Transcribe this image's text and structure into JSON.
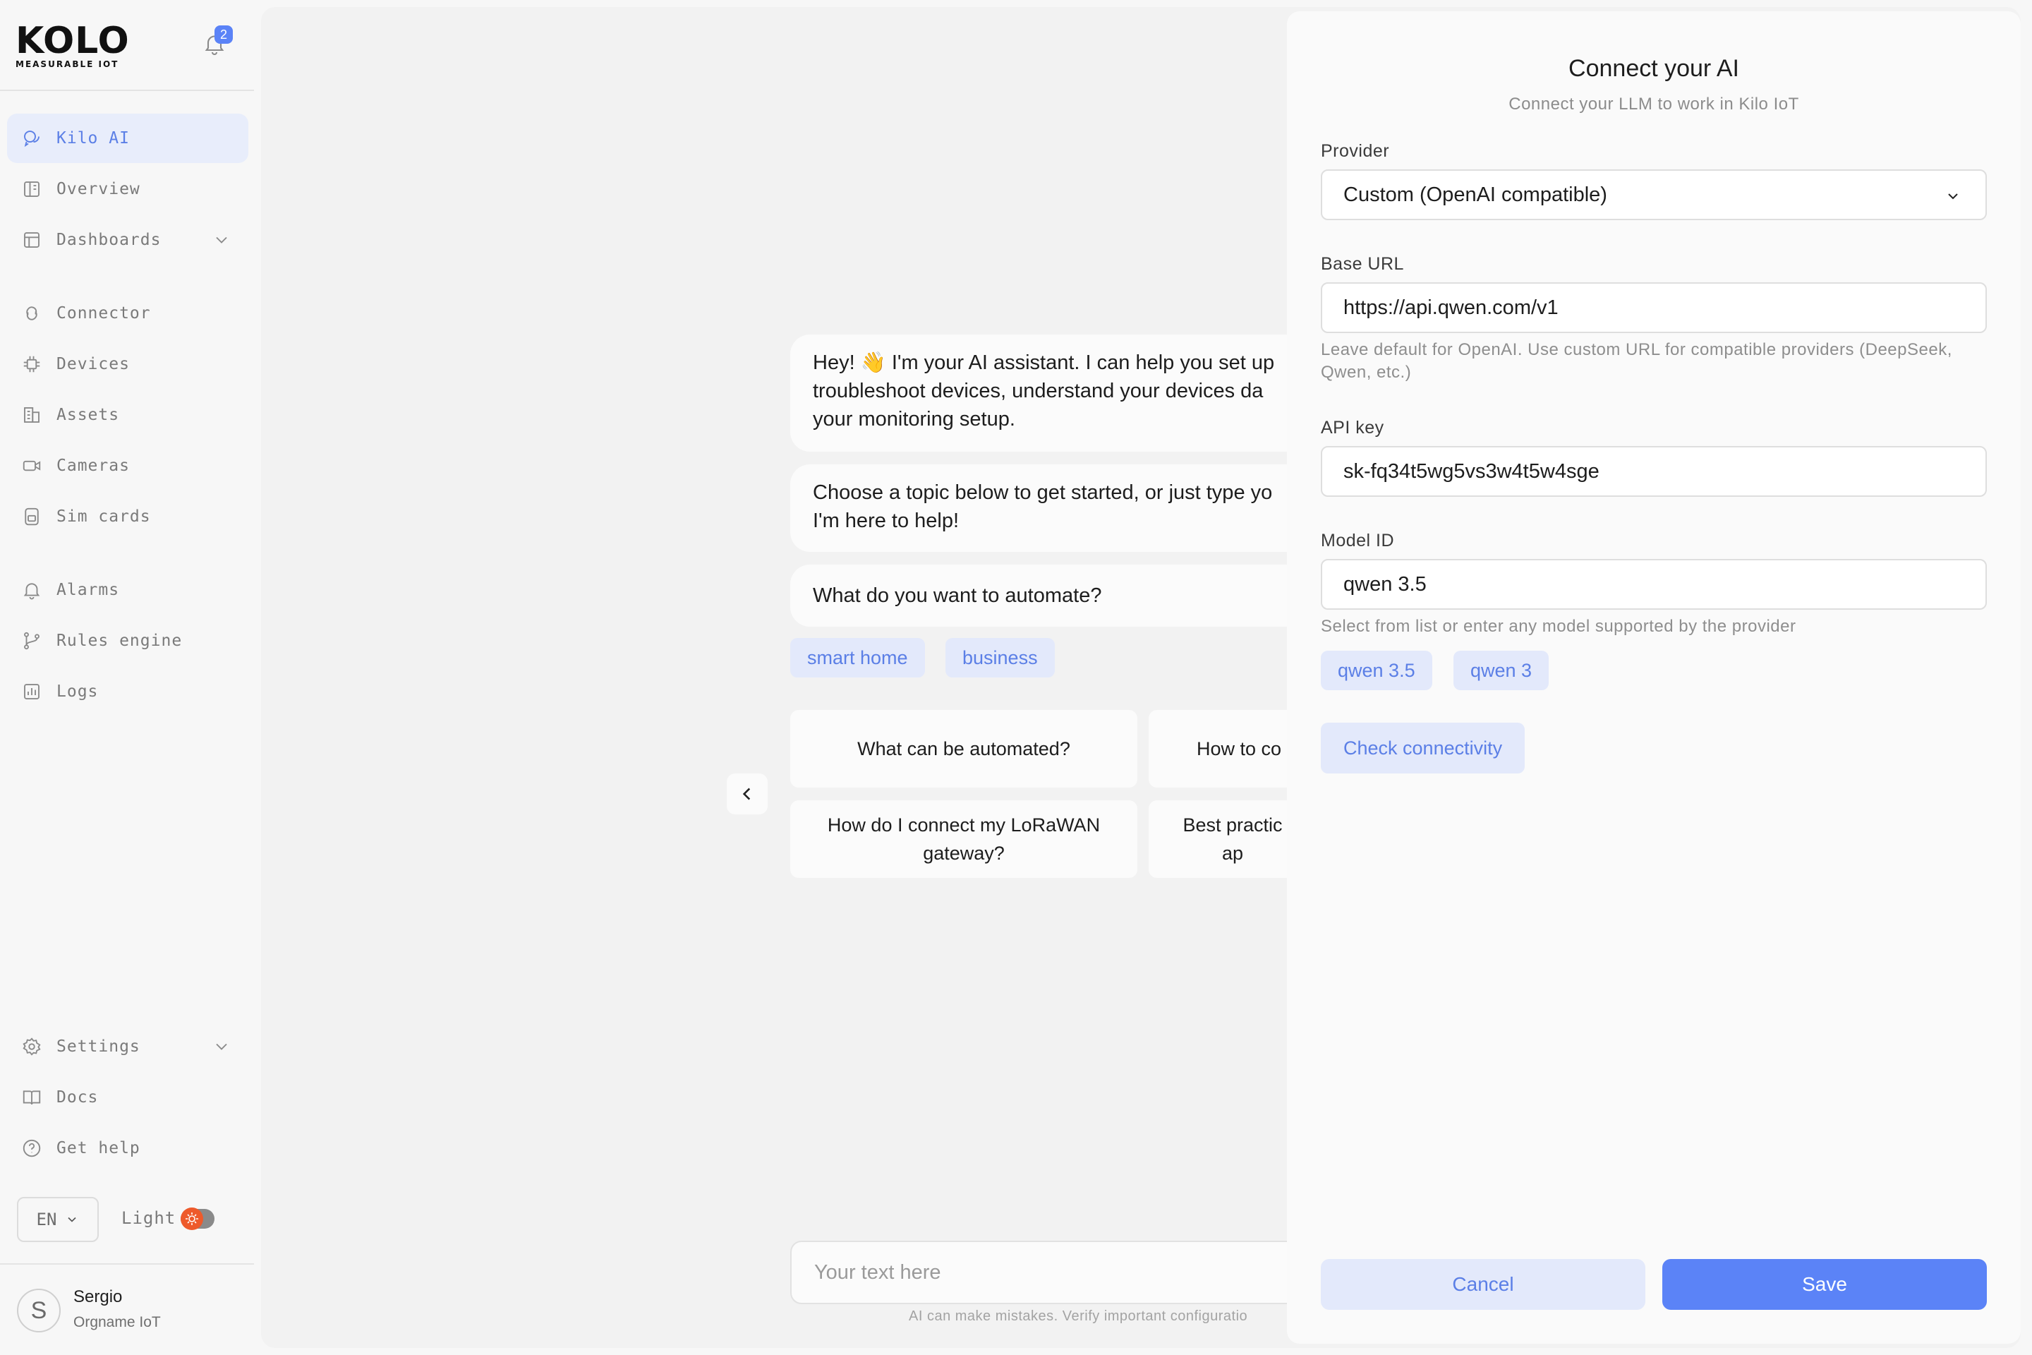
{
  "sidebar": {
    "logo": {
      "text": "KOLO",
      "subtitle": "MEASURABLE IOT"
    },
    "notifications_count": "2",
    "nav_top": [
      {
        "label": "Kilo AI",
        "icon": "chat-icon",
        "active": true
      },
      {
        "label": "Overview",
        "icon": "overview-icon"
      },
      {
        "label": "Dashboards",
        "icon": "dashboard-icon"
      }
    ],
    "nav_mid": [
      {
        "label": "Connector",
        "icon": "connector-icon"
      },
      {
        "label": "Devices",
        "icon": "chip-icon"
      },
      {
        "label": "Assets",
        "icon": "building-icon"
      },
      {
        "label": "Cameras",
        "icon": "camera-icon"
      },
      {
        "label": "Sim cards",
        "icon": "sim-card-icon"
      }
    ],
    "nav_low": [
      {
        "label": "Alarms",
        "icon": "bell-icon"
      },
      {
        "label": "Rules engine",
        "icon": "branch-icon"
      },
      {
        "label": "Logs",
        "icon": "chart-icon"
      }
    ],
    "nav_bottom": [
      {
        "label": "Settings",
        "icon": "gear-icon"
      },
      {
        "label": "Docs",
        "icon": "book-icon"
      },
      {
        "label": "Get help",
        "icon": "help-icon"
      }
    ],
    "language": "EN",
    "theme_label": "Light",
    "user": {
      "initial": "S",
      "name": "Sergio",
      "org": "Orgname IoT"
    }
  },
  "chat": {
    "greeting_line1": "Hey! 👋 I'm your AI assistant. I can help you set up",
    "greeting_line2": "troubleshoot devices, understand your devices da",
    "greeting_line3": "your monitoring setup.",
    "topic_line1": "Choose a topic below to get started, or just type yo",
    "topic_line2": "I'm here to help!",
    "question": "What do you want to automate?",
    "chips": [
      "smart home",
      "business"
    ],
    "cards": [
      "What can be automated?",
      "How to co",
      "How do I connect my LoRaWAN gateway?",
      "Best practic ap"
    ],
    "input_placeholder": "Your text here",
    "disclaimer": "AI can make mistakes. Verify important configuratio"
  },
  "modal": {
    "title": "Connect your AI",
    "subtitle": "Connect your LLM to work in Kilo IoT",
    "provider_label": "Provider",
    "provider_value": "Custom (OpenAI compatible)",
    "base_url_label": "Base URL",
    "base_url_value": "https://api.qwen.com/v1",
    "base_url_hint": "Leave default for OpenAI. Use custom URL for compatible providers (DeepSeek, Qwen, etc.)",
    "api_key_label": "API key",
    "api_key_value": "sk-fq34t5wg5vs3w4t5w4sge",
    "model_label": "Model ID",
    "model_value": "qwen 3.5",
    "model_hint": "Select from list or enter any model supported by the provider",
    "model_chips": [
      "qwen 3.5",
      "qwen 3"
    ],
    "check_label": "Check connectivity",
    "cancel_label": "Cancel",
    "save_label": "Save"
  },
  "colors": {
    "accent": "#5b83f7",
    "accent_soft": "#e3e9fb",
    "toggle_orange": "#ee5a2b"
  }
}
